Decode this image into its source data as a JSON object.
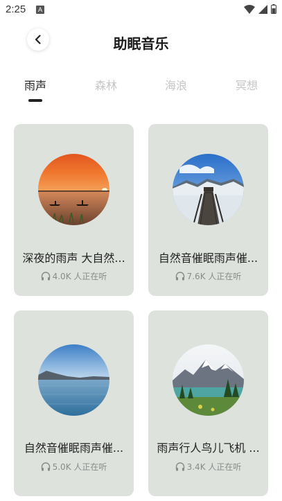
{
  "status_bar": {
    "time": "2:25",
    "notification_badge": "A"
  },
  "header": {
    "title": "助眠音乐",
    "back_icon": "chevron-left-icon"
  },
  "tabs": [
    {
      "label": "雨声",
      "active": true
    },
    {
      "label": "森林",
      "active": false
    },
    {
      "label": "海浪",
      "active": false
    },
    {
      "label": "冥想",
      "active": false
    }
  ],
  "cards": [
    {
      "title": "深夜的雨声 大自然...",
      "listeners": "4.0K 人正在听",
      "image": "sunset-kayak-lake"
    },
    {
      "title": "自然音催眠雨声催...",
      "listeners": "7.6K 人正在听",
      "image": "mountain-boardwalk-snow"
    },
    {
      "title": "自然音催眠雨声催...",
      "listeners": "5.0K 人正在听",
      "image": "lake-blue-sky"
    },
    {
      "title": "雨声行人鸟儿飞机 ...",
      "listeners": "3.4K 人正在听",
      "image": "alpine-lake-mountains"
    }
  ],
  "colors": {
    "card_bg": "#dde3dc",
    "active_tab": "#222222",
    "inactive_tab": "#c6c6c6",
    "meta_text": "#8a8a8a"
  }
}
